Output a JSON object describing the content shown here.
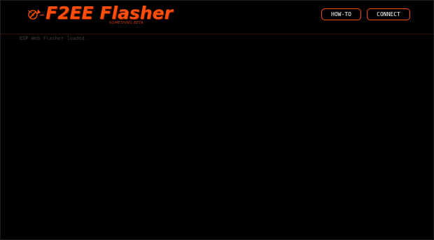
{
  "app": {
    "title": "F2EE Flasher",
    "subtitle": "SOMETHING.BETA"
  },
  "header": {
    "buttons": {
      "howto_label": "HOW-TO",
      "connect_label": "CONNECT"
    }
  },
  "console": {
    "lines": [
      "ESP Web Flasher loaded."
    ]
  },
  "colors": {
    "accent": "#ff4d0a",
    "background": "#000000",
    "console_text": "#3c3c3c"
  },
  "icons": {
    "logo": "flame-logo-icon"
  }
}
